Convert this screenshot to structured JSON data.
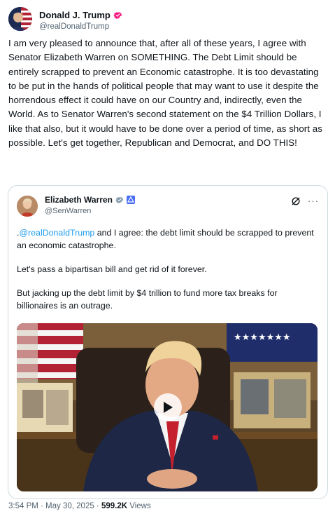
{
  "author": {
    "name": "Donald J. Trump",
    "handle": "@realDonaldTrump"
  },
  "tweet": {
    "text": "I am very pleased to announce that, after all of these years, I agree with Senator Elizabeth Warren on SOMETHING. The Debt Limit should be entirely scrapped to prevent an Economic catastrophe. It is too devastating to be put in the hands of political people that may want to use it despite the horrendous effect it could have on our Country and, indirectly, even the World. As to Senator Warren's second statement on the $4 Trillion Dollars, I like that also, but it would have to be done over a period of time, as short as possible. Let's get together, Republican and Democrat, and DO THIS!"
  },
  "quoted": {
    "name": "Elizabeth Warren",
    "handle": "@SenWarren",
    "mention": "@realDonaldTrump",
    "text_p1_prefix": ".",
    "text_p1_suffix": " and I agree: the debt limit should be scrapped to prevent an economic catastrophe.",
    "text_p2": "Let's pass a bipartisan bill and get rid of it forever.",
    "text_p3": "But jacking up the debt limit by $4 trillion to fund more tax breaks for billionaires is an outrage.",
    "more_label": "···"
  },
  "footer": {
    "time": "3:54 PM · May 30, 2025 · ",
    "views_count": "599.2K",
    "views_label": " Views"
  },
  "colors": {
    "link": "#1d9bf0",
    "verified": "#f91880",
    "gov_badge": "#829aab"
  },
  "icons": {
    "verified": "verified-badge-icon",
    "gov": "government-badge-icon",
    "grok": "grok-icon",
    "more": "more-icon",
    "play": "play-icon"
  }
}
